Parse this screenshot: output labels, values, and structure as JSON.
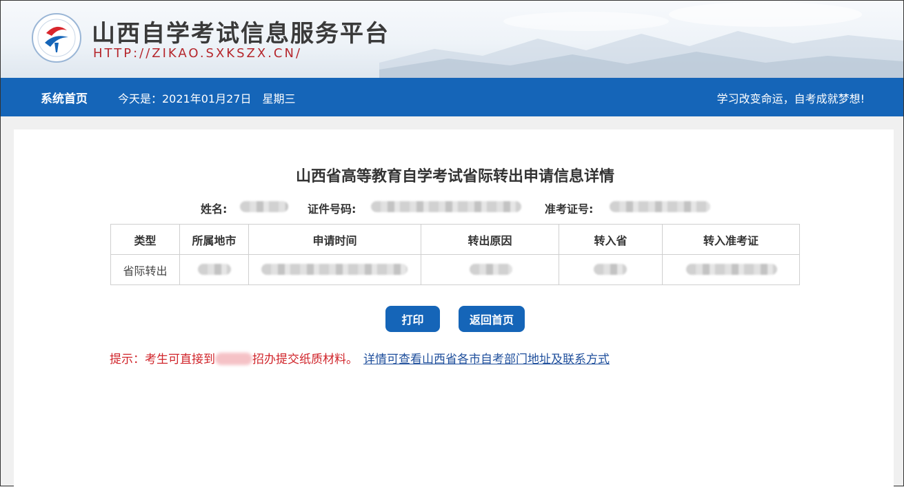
{
  "header": {
    "site_title": "山西自学考试信息服务平台",
    "site_url": "HTTP://ZIKAO.SXKSZX.CN/"
  },
  "navbar": {
    "home": "系统首页",
    "date_text": "今天是：2021年01月27日　星期三",
    "slogan": "学习改变命运，自考成就梦想!"
  },
  "main": {
    "title": "山西省高等教育自学考试省际转出申请信息详情",
    "name_label": "姓名:",
    "id_label": "证件号码:",
    "exam_no_label": "准考证号:",
    "table": {
      "headers": [
        "类型",
        "所属地市",
        "申请时间",
        "转出原因",
        "转入省",
        "转入准考证"
      ],
      "row": {
        "type": "省际转出"
      }
    },
    "buttons": {
      "print": "打印",
      "back": "返回首页"
    },
    "tip": {
      "prefix": "提示：考生可直接到",
      "suffix": "招办提交纸质材料。",
      "link": "详情可查看山西省各市自考部门地址及联系方式"
    }
  },
  "colors": {
    "nav_blue": "#1565b8",
    "tip_red": "#d0242a",
    "link_blue": "#1f4f9c"
  }
}
